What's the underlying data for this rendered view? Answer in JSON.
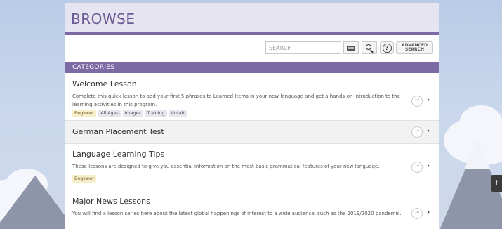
{
  "header": {
    "title": "BROWSE"
  },
  "toolbar": {
    "search_placeholder": "SEARCH",
    "advanced_search_line1": "ADVANCED",
    "advanced_search_line2": "SEARCH",
    "help_glyph": "?"
  },
  "categories": {
    "label": "CATEGORIES"
  },
  "items": [
    {
      "title": "Welcome Lesson",
      "description": "Complete this quick lesson to add your first 5 phrases to Learned Items in your new language and get a hands-on introduction to the learning activities in this program.",
      "tags": [
        "Beginner",
        "All Ages",
        "Images",
        "Training",
        "Vocab"
      ]
    },
    {
      "title": "German Placement Test"
    },
    {
      "title": "Language Learning Tips",
      "description": "These lessons are designed to give you essential information on the most basic grammatical features of your new language.",
      "tags": [
        "Beginner"
      ]
    },
    {
      "title": "Major News Lessons",
      "description": "You will find a lesson series here about the latest global happenings of interest to a wide audience, such as the 2019/2020 pandemic."
    }
  ],
  "more_glyph": "···",
  "chevron_glyph": "›",
  "scroll_top_glyph": "↑",
  "icons": {
    "keyboard": "keyboard-icon",
    "search": "search-icon",
    "help": "help-icon",
    "more": "more-icon",
    "chevron": "chevron-right-icon",
    "scroll_top": "arrow-up-icon"
  },
  "colors": {
    "accent": "#7c6aa5",
    "header_bg": "#e7e4f1",
    "title": "#6a5a93"
  }
}
